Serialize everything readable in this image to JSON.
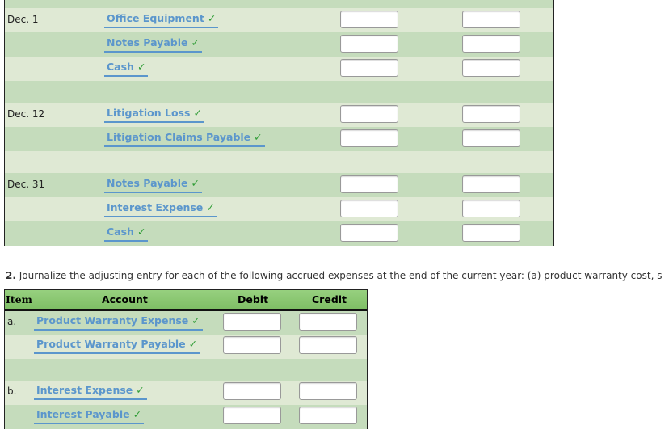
{
  "table1": {
    "rows": [
      {
        "date": "Dec. 1",
        "account": "Office Equipment"
      },
      {
        "date": "",
        "account": "Notes Payable"
      },
      {
        "date": "",
        "account": "Cash"
      },
      {
        "date": "Dec. 12",
        "account": "Litigation Loss"
      },
      {
        "date": "",
        "account": "Litigation Claims Payable"
      },
      {
        "date": "Dec. 31",
        "account": "Notes Payable"
      },
      {
        "date": "",
        "account": "Interest Expense"
      },
      {
        "date": "",
        "account": "Cash"
      }
    ]
  },
  "question2": {
    "number": "2.",
    "text": " Journalize the adjusting entry for each of the following accrued expenses at the end of the current year: (a) product warranty cost, s"
  },
  "table2": {
    "headers": {
      "item": "Item",
      "account": "Account",
      "debit": "Debit",
      "credit": "Credit"
    },
    "rows": [
      {
        "item": "a.",
        "account": "Product Warranty Expense"
      },
      {
        "item": "",
        "account": "Product Warranty Payable"
      },
      {
        "item": "b.",
        "account": "Interest Expense"
      },
      {
        "item": "",
        "account": "Interest Payable"
      }
    ]
  },
  "check_icon": "✓",
  "colors": {
    "row_dark": "#c5dcbc",
    "row_light": "#dfe9d4",
    "header": "#8fcb78",
    "account_text": "#5b96cc",
    "check": "#2e9c35"
  }
}
